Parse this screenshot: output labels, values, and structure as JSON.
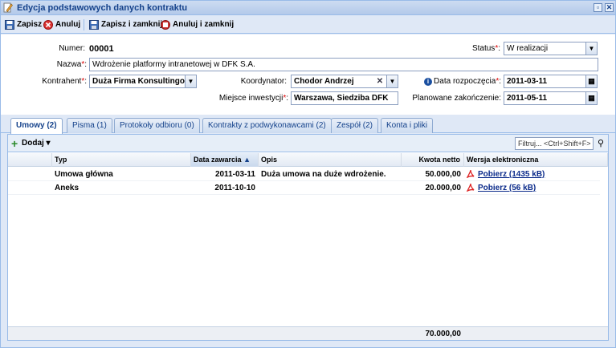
{
  "window": {
    "title": "Edycja podstawowych danych kontraktu"
  },
  "toolbar": {
    "save_label": "Zapisz",
    "cancel_label": "Anuluj",
    "save_close_label": "Zapisz i zamknij",
    "cancel_close_label": "Anuluj i zamknij"
  },
  "form": {
    "number_label": "Numer:",
    "number_value": "00001",
    "status_label": "Status",
    "status_value": "W realizacji",
    "name_label": "Nazwa",
    "name_value": "Wdrożenie platformy intranetowej w DFK S.A.",
    "contractor_label": "Kontrahent",
    "contractor_value": "Duża Firma Konsultingowa",
    "coordinator_label": "Koordynator:",
    "coordinator_value": "Chodor Andrzej",
    "start_label": "Data rozpoczęcia",
    "start_value": "2011-03-11",
    "location_label": "Miejsce inwestycji",
    "location_value": "Warszawa, Siedziba DFK",
    "planned_end_label": "Planowane zakończenie:",
    "planned_end_value": "2011-05-11",
    "required_mark": "*",
    "colon": ":"
  },
  "tabs": [
    {
      "label": "Umowy (2)",
      "active": true
    },
    {
      "label": "Pisma (1)",
      "active": false
    },
    {
      "label": "Protokoły odbioru (0)",
      "active": false
    },
    {
      "label": "Kontrakty z podwykonawcami (2)",
      "active": false
    },
    {
      "label": "Zespół (2)",
      "active": false
    },
    {
      "label": "Konta i pliki",
      "active": false
    }
  ],
  "grid": {
    "add_label": "Dodaj",
    "filter_placeholder": "Filtruj...   <Ctrl+Shift+F>",
    "columns": [
      "Typ",
      "Data zawarcia",
      "Opis",
      "Kwota netto",
      "Wersja elektroniczna"
    ],
    "rows": [
      {
        "typ": "Umowa główna",
        "data": "2011-03-11",
        "opis": "Duża umowa na duże wdrożenie.",
        "kwota": "50.000,00",
        "plik": "Pobierz (1435 kB)"
      },
      {
        "typ": "Aneks",
        "data": "2011-10-10",
        "opis": "",
        "kwota": "20.000,00",
        "plik": "Pobierz (56 kB)"
      }
    ],
    "total": "70.000,00"
  },
  "colors": {
    "accent": "#15428b",
    "border": "#99bbe8",
    "required": "#dd0000"
  }
}
